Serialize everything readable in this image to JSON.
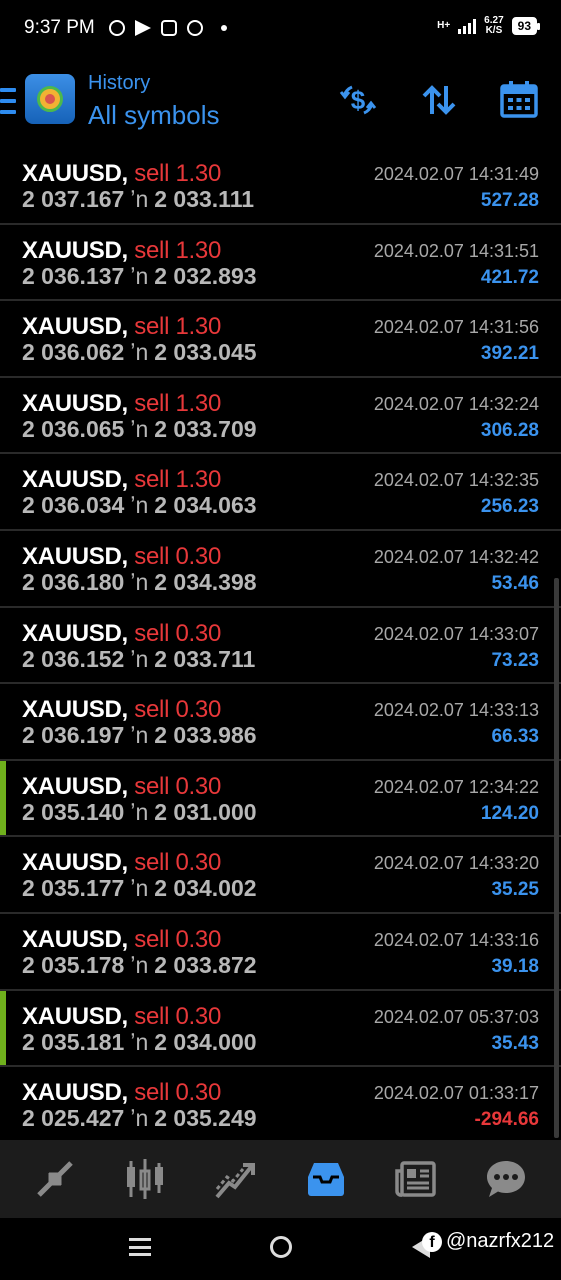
{
  "status_bar": {
    "time": "9:37 PM",
    "network": "H+",
    "speed_value": "6.27",
    "speed_unit": "K/S",
    "battery": "93"
  },
  "header": {
    "subtitle": "History",
    "title": "All symbols",
    "icons": [
      "menu-icon",
      "mt5-logo",
      "currency-exchange-icon",
      "sort-icon",
      "calendar-icon"
    ]
  },
  "colors": {
    "accent": "#3b93ee",
    "sell": "#e8383a",
    "profit_positive": "#3b93ee",
    "profit_negative": "#e8383a",
    "marker": "#6fb01c"
  },
  "trades": [
    {
      "symbol": "XAUUSD,",
      "side": "sell 1.30",
      "open": "2 037.167",
      "close": "2 033.111",
      "time": "2024.02.07 14:31:49",
      "profit": "527.28",
      "marked": false,
      "negative": false
    },
    {
      "symbol": "XAUUSD,",
      "side": "sell 1.30",
      "open": "2 036.137",
      "close": "2 032.893",
      "time": "2024.02.07 14:31:51",
      "profit": "421.72",
      "marked": false,
      "negative": false
    },
    {
      "symbol": "XAUUSD,",
      "side": "sell 1.30",
      "open": "2 036.062",
      "close": "2 033.045",
      "time": "2024.02.07 14:31:56",
      "profit": "392.21",
      "marked": false,
      "negative": false
    },
    {
      "symbol": "XAUUSD,",
      "side": "sell 1.30",
      "open": "2 036.065",
      "close": "2 033.709",
      "time": "2024.02.07 14:32:24",
      "profit": "306.28",
      "marked": false,
      "negative": false
    },
    {
      "symbol": "XAUUSD,",
      "side": "sell 1.30",
      "open": "2 036.034",
      "close": "2 034.063",
      "time": "2024.02.07 14:32:35",
      "profit": "256.23",
      "marked": false,
      "negative": false
    },
    {
      "symbol": "XAUUSD,",
      "side": "sell 0.30",
      "open": "2 036.180",
      "close": "2 034.398",
      "time": "2024.02.07 14:32:42",
      "profit": "53.46",
      "marked": false,
      "negative": false
    },
    {
      "symbol": "XAUUSD,",
      "side": "sell 0.30",
      "open": "2 036.152",
      "close": "2 033.711",
      "time": "2024.02.07 14:33:07",
      "profit": "73.23",
      "marked": false,
      "negative": false
    },
    {
      "symbol": "XAUUSD,",
      "side": "sell 0.30",
      "open": "2 036.197",
      "close": "2 033.986",
      "time": "2024.02.07 14:33:13",
      "profit": "66.33",
      "marked": false,
      "negative": false
    },
    {
      "symbol": "XAUUSD,",
      "side": "sell 0.30",
      "open": "2 035.140",
      "close": "2 031.000",
      "time": "2024.02.07 12:34:22",
      "profit": "124.20",
      "marked": true,
      "negative": false
    },
    {
      "symbol": "XAUUSD,",
      "side": "sell 0.30",
      "open": "2 035.177",
      "close": "2 034.002",
      "time": "2024.02.07 14:33:20",
      "profit": "35.25",
      "marked": false,
      "negative": false
    },
    {
      "symbol": "XAUUSD,",
      "side": "sell 0.30",
      "open": "2 035.178",
      "close": "2 033.872",
      "time": "2024.02.07 14:33:16",
      "profit": "39.18",
      "marked": false,
      "negative": false
    },
    {
      "symbol": "XAUUSD,",
      "side": "sell 0.30",
      "open": "2 035.181",
      "close": "2 034.000",
      "time": "2024.02.07 05:37:03",
      "profit": "35.43",
      "marked": true,
      "negative": false
    },
    {
      "symbol": "XAUUSD,",
      "side": "sell 0.30",
      "open": "2 025.427",
      "close": "2 035.249",
      "time": "2024.02.07 01:33:17",
      "profit": "-294.66",
      "marked": false,
      "negative": true
    }
  ],
  "arrow_glyph": "ʼn",
  "bottom_nav": [
    {
      "name": "quotes-icon",
      "active": false
    },
    {
      "name": "chart-icon",
      "active": false
    },
    {
      "name": "trade-icon",
      "active": false
    },
    {
      "name": "history-icon",
      "active": true
    },
    {
      "name": "news-icon",
      "active": false
    },
    {
      "name": "messages-icon",
      "active": false
    }
  ],
  "watermark": "@nazrfx212"
}
